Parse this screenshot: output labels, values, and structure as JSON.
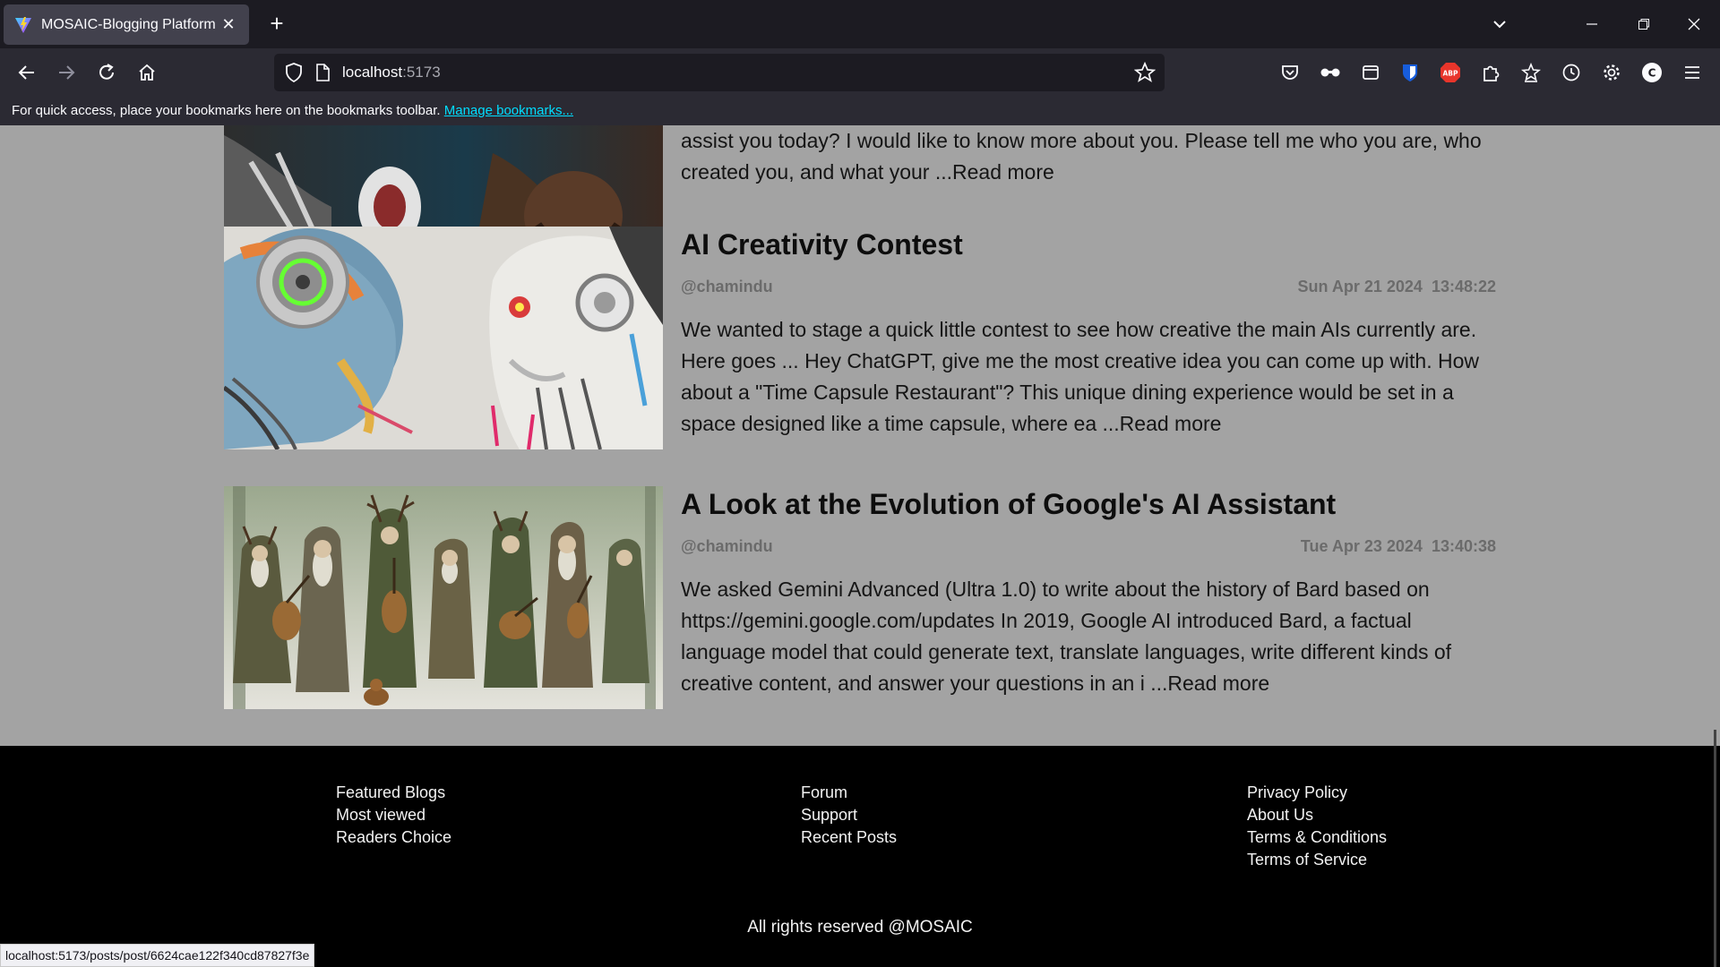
{
  "browser": {
    "tab_title": "MOSAIC-Blogging Platform",
    "tab_favicon": "vite-logo-icon",
    "url_host": "localhost",
    "url_port": ":5173",
    "bookmarks_message": "For quick access, place your bookmarks here on the bookmarks toolbar.",
    "manage_bookmarks": "Manage bookmarks...",
    "status_url": "localhost:5173/posts/post/6624cae122f340cd87827f3e",
    "profile_initial": "C",
    "abp_label": "ABP"
  },
  "posts": [
    {
      "excerpt": "assist you today? I would like to know more about you. Please tell me who you are, who created you, and what your ...",
      "read_more": "Read more",
      "image": "robot-portrait-image"
    },
    {
      "title": "AI Creativity Contest",
      "author": "@chamindu",
      "date": "Sun Apr 21 2024",
      "time": "13:48:22",
      "excerpt": "We wanted to stage a quick little contest to see how creative the main AIs currently are. Here goes ... Hey ChatGPT, give me the most creative idea you can come up with. How about a \"Time Capsule Restaurant\"? This unique dining experience would be set in a space designed like a time capsule, where ea ...",
      "read_more": "Read more",
      "image": "two-robots-image"
    },
    {
      "title": "A Look at the Evolution of Google's AI Assistant",
      "author": "@chamindu",
      "date": "Tue Apr 23 2024",
      "time": "13:40:38",
      "excerpt": "We asked Gemini Advanced (Ultra 1.0) to write about the history of Bard based on https://gemini.google.com/updates In 2019, Google AI introduced Bard, a factual language model that could generate text, translate languages, write different kinds of creative content, and answer your questions in an i ...",
      "read_more": "Read more",
      "image": "forest-bards-image"
    }
  ],
  "footer": {
    "col1": [
      "Featured Blogs",
      "Most viewed",
      "Readers Choice"
    ],
    "col2": [
      "Forum",
      "Support",
      "Recent Posts"
    ],
    "col3": [
      "Privacy Policy",
      "About Us",
      "Terms & Conditions",
      "Terms of Service"
    ],
    "copyright": "All rights reserved @MOSAIC"
  },
  "colors": {
    "page_bg": "#a3a3a3",
    "footer_bg": "#000000",
    "link_blue": "#00ddff"
  }
}
